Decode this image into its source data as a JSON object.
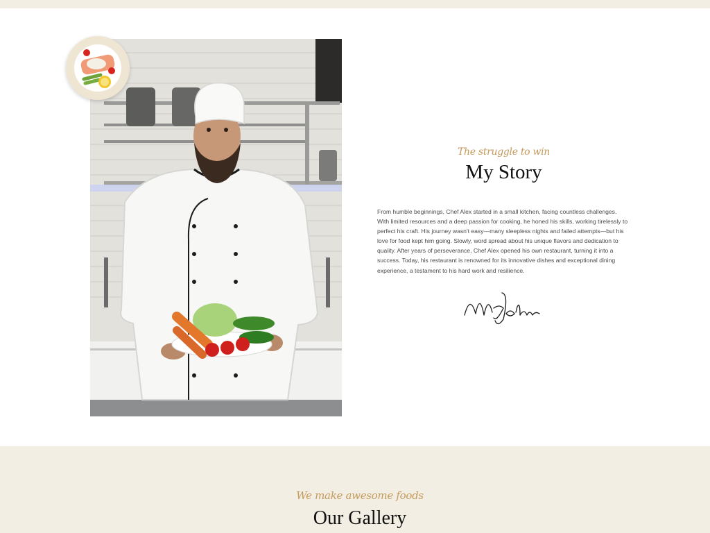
{
  "story": {
    "eyebrow": "The struggle to win",
    "title": "My Story",
    "body": "From humble beginnings, Chef Alex started in a small kitchen, facing countless challenges. With limited resources and a deep passion for cooking, he honed his skills, working tirelessly to perfect his craft. His journey wasn't easy—many sleepless nights and failed attempts—but his love for food kept him going. Slowly, word spread about his unique flavors and dedication to quality. After years of perseverance, Chef Alex opened his own restaurant, turning it into a success. Today, his restaurant is renowned for its innovative dishes and exceptional dining experience, a testament to his hard work and resilience.",
    "signature": "Mr. Johns"
  },
  "gallery": {
    "eyebrow": "We make awesome foods",
    "title": "Our Gallery"
  },
  "images": {
    "chef_photo": "chef-holding-vegetable-plate",
    "dish_badge": "salmon-asparagus-dish"
  },
  "colors": {
    "accent": "#c49a5b",
    "section_bg": "#f3eee4",
    "heading": "#111111",
    "body_text": "#4a4a4a"
  }
}
